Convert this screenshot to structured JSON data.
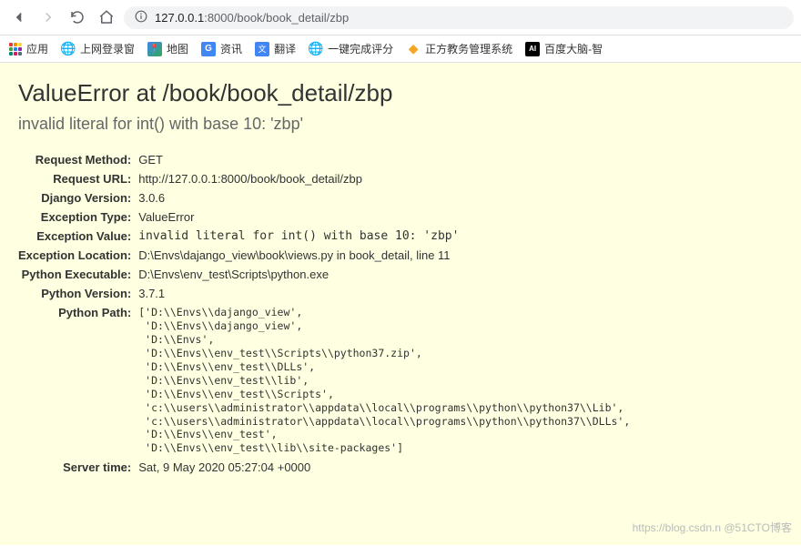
{
  "toolbar": {
    "url_prefix": "127.0.0.1",
    "url_rest": ":8000/book/book_detail/zbp"
  },
  "bookmarks": {
    "apps": "应用",
    "items": [
      {
        "label": "上网登录窗"
      },
      {
        "label": "地图"
      },
      {
        "label": "资讯"
      },
      {
        "label": "翻译"
      },
      {
        "label": "一键完成评分"
      },
      {
        "label": "正方教务管理系统"
      },
      {
        "label": "百度大脑-智"
      }
    ]
  },
  "error": {
    "title": "ValueError at /book/book_detail/zbp",
    "message": "invalid literal for int() with base 10: 'zbp'",
    "rows": {
      "request_method": {
        "label": "Request Method:",
        "value": "GET"
      },
      "request_url": {
        "label": "Request URL:",
        "value": "http://127.0.0.1:8000/book/book_detail/zbp"
      },
      "django_version": {
        "label": "Django Version:",
        "value": "3.0.6"
      },
      "exception_type": {
        "label": "Exception Type:",
        "value": "ValueError"
      },
      "exception_value": {
        "label": "Exception Value:",
        "value": "invalid literal for int() with base 10: 'zbp'"
      },
      "exception_location": {
        "label": "Exception Location:",
        "value": "D:\\Envs\\dajango_view\\book\\views.py in book_detail, line 11"
      },
      "python_executable": {
        "label": "Python Executable:",
        "value": "D:\\Envs\\env_test\\Scripts\\python.exe"
      },
      "python_version": {
        "label": "Python Version:",
        "value": "3.7.1"
      },
      "python_path": {
        "label": "Python Path:",
        "value": "['D:\\\\Envs\\\\dajango_view',\n 'D:\\\\Envs\\\\dajango_view',\n 'D:\\\\Envs',\n 'D:\\\\Envs\\\\env_test\\\\Scripts\\\\python37.zip',\n 'D:\\\\Envs\\\\env_test\\\\DLLs',\n 'D:\\\\Envs\\\\env_test\\\\lib',\n 'D:\\\\Envs\\\\env_test\\\\Scripts',\n 'c:\\\\users\\\\administrator\\\\appdata\\\\local\\\\programs\\\\python\\\\python37\\\\Lib',\n 'c:\\\\users\\\\administrator\\\\appdata\\\\local\\\\programs\\\\python\\\\python37\\\\DLLs',\n 'D:\\\\Envs\\\\env_test',\n 'D:\\\\Envs\\\\env_test\\\\lib\\\\site-packages']"
      },
      "server_time": {
        "label": "Server time:",
        "value": "Sat, 9 May 2020 05:27:04 +0000"
      }
    }
  },
  "watermark": "https://blog.csdn.n @51CTO博客"
}
